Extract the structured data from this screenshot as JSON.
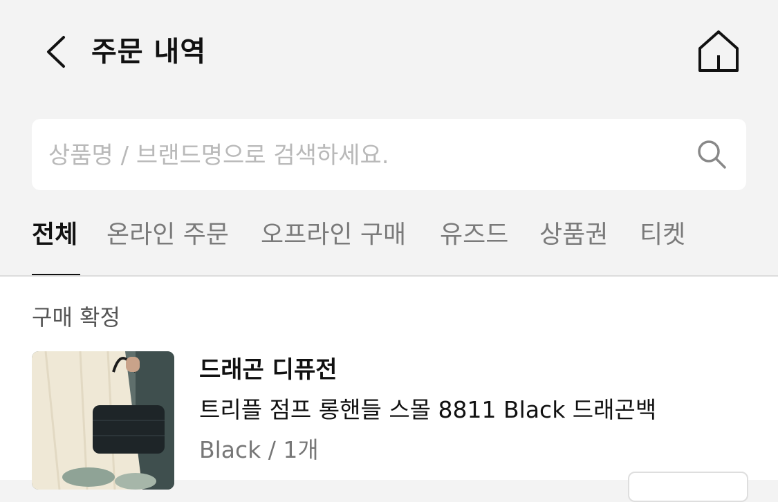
{
  "header": {
    "title": "주문 내역",
    "back_icon": "chevron-left-icon",
    "home_icon": "home-icon"
  },
  "search": {
    "placeholder": "상품명 / 브랜드명으로 검색하세요.",
    "value": "",
    "icon": "search-icon"
  },
  "tabs": [
    {
      "label": "전체",
      "active": true
    },
    {
      "label": "온라인 주문",
      "active": false
    },
    {
      "label": "오프라인 구매",
      "active": false
    },
    {
      "label": "유즈드",
      "active": false
    },
    {
      "label": "상품권",
      "active": false
    },
    {
      "label": "티켓",
      "active": false
    }
  ],
  "orders": [
    {
      "status": "구매 확정",
      "brand": "드래곤 디퓨전",
      "product_name": "트리플 점프 롱핸들 스몰 8811 Black 드래곤백",
      "option": "Black / 1개"
    }
  ],
  "colors": {
    "background": "#f3f3f3",
    "surface": "#ffffff",
    "text_primary": "#111111",
    "text_secondary": "#7a7a7a",
    "placeholder": "#b9b9b9"
  }
}
